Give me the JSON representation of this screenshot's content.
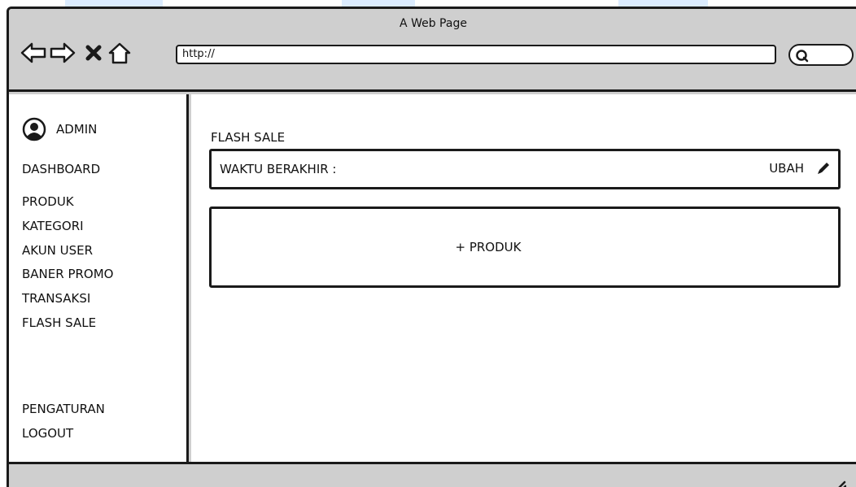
{
  "window": {
    "title": "A Web Page"
  },
  "toolbar": {
    "url": "http://",
    "icons": [
      "back-arrow-icon",
      "forward-arrow-icon",
      "close-x-icon",
      "home-icon",
      "search-icon"
    ]
  },
  "sidebar": {
    "admin_label": "ADMIN",
    "items": [
      {
        "label": "DASHBOARD"
      },
      {
        "label": "PRODUK"
      },
      {
        "label": "KATEGORI"
      },
      {
        "label": "AKUN USER"
      },
      {
        "label": "BANER PROMO"
      },
      {
        "label": "TRANSAKSI"
      },
      {
        "label": "FLASH SALE"
      }
    ],
    "bottom_items": [
      {
        "label": "PENGATURAN"
      },
      {
        "label": "LOGOUT"
      }
    ]
  },
  "main": {
    "title": "FLASH SALE",
    "end_time_label": "WAKTU BERAKHIR :",
    "edit_label": "UBAH",
    "add_product_label": "+ PRODUK"
  },
  "colors": {
    "chrome": "#cfcfcf",
    "border": "#1a1a1a",
    "content_bg": "#ffffff",
    "watermark": "#dcecff"
  }
}
